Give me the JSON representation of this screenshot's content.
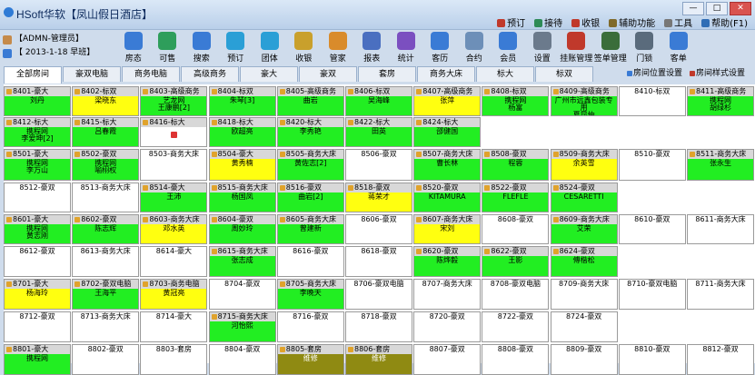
{
  "window": {
    "title": "HSoft华软【凤山假日酒店】",
    "buttons": [
      "—",
      "□",
      "✕"
    ]
  },
  "topmenu": [
    {
      "label": "预订",
      "color": "#c0392b"
    },
    {
      "label": "接待",
      "color": "#2e8b57"
    },
    {
      "label": "收银",
      "color": "#c0392b"
    },
    {
      "label": "辅助功能",
      "color": "#7f6a2b"
    },
    {
      "label": "工具",
      "color": "#777777"
    },
    {
      "label": "帮助(F1)",
      "color": "#2f6db5"
    }
  ],
  "user": {
    "name": "【ADMN-管理员】",
    "date": "【 2013-1-18 早班】"
  },
  "toolbar": [
    {
      "label": "房态",
      "icon": "home-icon",
      "color": "#3a7bd5"
    },
    {
      "label": "可售",
      "icon": "tag-icon",
      "color": "#2e9e5b"
    },
    {
      "label": "搜索",
      "icon": "search-icon",
      "color": "#3a7bd5"
    },
    {
      "label": "预订",
      "icon": "clock-icon",
      "color": "#2a9fd6"
    },
    {
      "label": "团体",
      "icon": "globe-icon",
      "color": "#2a9fd6"
    },
    {
      "label": "收银",
      "icon": "coins-icon",
      "color": "#c9a02c"
    },
    {
      "label": "管家",
      "icon": "broom-icon",
      "color": "#d98b2b"
    },
    {
      "label": "报表",
      "icon": "chart-icon",
      "color": "#4a6fc0"
    },
    {
      "label": "统计",
      "icon": "stats-icon",
      "color": "#7b4fc0"
    },
    {
      "label": "客历",
      "icon": "people-icon",
      "color": "#3a7bd5"
    },
    {
      "label": "合约",
      "icon": "contract-icon",
      "color": "#6d8fb8"
    },
    {
      "label": "会员",
      "icon": "member-icon",
      "color": "#3a7bd5"
    },
    {
      "label": "设置",
      "icon": "gear-icon",
      "color": "#6b7a8c"
    },
    {
      "label": "挂账管理",
      "icon": "ledger-icon",
      "color": "#c0392b"
    },
    {
      "label": "签单管理",
      "icon": "manager-icon",
      "color": "#3a6d3a"
    },
    {
      "label": "门锁",
      "icon": "lock-icon",
      "color": "#5a6b7c"
    },
    {
      "label": "客单",
      "icon": "guest-icon",
      "color": "#3a7bd5"
    }
  ],
  "tabs": [
    "全部房间",
    "豪双电脑",
    "商务电脑",
    "高级商务",
    "豪大",
    "豪双",
    "套房",
    "商务大床",
    "标大",
    "标双"
  ],
  "tab_actions": [
    {
      "label": "房间位置设置"
    },
    {
      "label": "房间样式设置"
    }
  ],
  "rows": [
    [
      {
        "hd": "8401-豪大",
        "st": "g",
        "l1": "刘丹"
      },
      {
        "hd": "8402-标双",
        "st": "y",
        "l1": "梁晓东"
      },
      {
        "hd": "8403-高级商务",
        "st": "g",
        "l1": "艺龙网",
        "l2": "王康鹏[2]"
      },
      {
        "hd": "8404-标双",
        "st": "g",
        "l1": "朱琴[3]"
      },
      {
        "hd": "8405-高级商务",
        "st": "g",
        "l1": "曲岩"
      },
      {
        "hd": "8406-标双",
        "st": "g",
        "l1": "吴海峰"
      },
      {
        "hd": "8407-高级商务",
        "st": "y",
        "l1": "张萍"
      },
      {
        "hd": "8408-标双",
        "st": "g",
        "l1": "携程网",
        "l2": "杨富"
      },
      {
        "hd": "8409-高级商务",
        "st": "g",
        "l1": "广州市远鑫包装专用",
        "l2": "夏昆仲"
      },
      {
        "hd": "8410-标双",
        "st": "plain"
      },
      {
        "hd": "8411-高级商务",
        "st": "g",
        "l1": "携程网",
        "l2": "胡绿杉"
      }
    ],
    [
      {
        "hd": "8412-标大",
        "st": "g",
        "l1": "携程网",
        "l2": "李爱坤[2]"
      },
      {
        "hd": "8415-标大",
        "st": "g",
        "l1": "吕春霞"
      },
      {
        "hd": "8416-标大",
        "st": "r",
        "dot": true
      },
      {
        "hd": "8418-标大",
        "st": "g",
        "l1": "欧超亮"
      },
      {
        "hd": "8420-标大",
        "st": "g",
        "l1": "李秀艳"
      },
      {
        "hd": "8422-标大",
        "st": "g",
        "l1": "田英"
      },
      {
        "hd": "8424-标大",
        "st": "g",
        "l1": "邵健国"
      },
      {
        "hd": "",
        "st": "none"
      },
      {
        "hd": "",
        "st": "none"
      },
      {
        "hd": "",
        "st": "none"
      },
      {
        "hd": "",
        "st": "none"
      }
    ],
    [
      {
        "hd": "8501-豪大",
        "st": "g",
        "l1": "携程网",
        "l2": "李万山"
      },
      {
        "hd": "8502-豪双",
        "st": "g",
        "l1": "携程网",
        "l2": "喻栩权"
      },
      {
        "hd": "8503-商务大床",
        "st": "plain"
      },
      {
        "hd": "8504-豪大",
        "st": "y",
        "l1": "黄秀楠"
      },
      {
        "hd": "8505-商务大床",
        "st": "g",
        "l1": "黄佐志[2]"
      },
      {
        "hd": "8506-豪双",
        "st": "plain"
      },
      {
        "hd": "8507-商务大床",
        "st": "g",
        "l1": "曹长林"
      },
      {
        "hd": "8508-豪双",
        "st": "g",
        "l1": "程蓉"
      },
      {
        "hd": "8509-商务大床",
        "st": "y",
        "l1": "余英雪"
      },
      {
        "hd": "8510-豪双",
        "st": "plain"
      },
      {
        "hd": "8511-商务大床",
        "st": "g",
        "l1": "张永生"
      }
    ],
    [
      {
        "hd": "8512-豪双",
        "st": "plain"
      },
      {
        "hd": "8513-商务大床",
        "st": "plain"
      },
      {
        "hd": "8514-豪大",
        "st": "g",
        "l1": "王沛"
      },
      {
        "hd": "8515-商务大床",
        "st": "g",
        "l1": "杨国凤"
      },
      {
        "hd": "8516-豪双",
        "st": "g",
        "l1": "曲岩[2]"
      },
      {
        "hd": "8518-豪双",
        "st": "y",
        "l1": "蒋荣才"
      },
      {
        "hd": "8520-豪双",
        "st": "g",
        "l1": "KITAMURA"
      },
      {
        "hd": "8522-豪双",
        "st": "g",
        "l1": "FLEFLE"
      },
      {
        "hd": "8524-豪双",
        "st": "g",
        "l1": "CESARETTI"
      },
      {
        "hd": "",
        "st": "none"
      },
      {
        "hd": "",
        "st": "none"
      }
    ],
    [
      {
        "hd": "8601-豪大",
        "st": "g",
        "l1": "携程网",
        "l2": "黄志刚"
      },
      {
        "hd": "8602-豪双",
        "st": "g",
        "l1": "陈志辉"
      },
      {
        "hd": "8603-商务大床",
        "st": "y",
        "l1": "邓水英"
      },
      {
        "hd": "8604-豪双",
        "st": "g",
        "l1": "周妙玲"
      },
      {
        "hd": "8605-商务大床",
        "st": "g",
        "l1": "曾建新"
      },
      {
        "hd": "8606-豪双",
        "st": "plain"
      },
      {
        "hd": "8607-商务大床",
        "st": "y",
        "l1": "宋刘"
      },
      {
        "hd": "8608-豪双",
        "st": "plain"
      },
      {
        "hd": "8609-商务大床",
        "st": "g",
        "l1": "艾荣"
      },
      {
        "hd": "8610-豪双",
        "st": "plain"
      },
      {
        "hd": "8611-商务大床",
        "st": "plain"
      }
    ],
    [
      {
        "hd": "8612-豪双",
        "st": "plain"
      },
      {
        "hd": "8613-商务大床",
        "st": "plain"
      },
      {
        "hd": "8614-豪大",
        "st": "plain"
      },
      {
        "hd": "8615-商务大床",
        "st": "g",
        "l1": "张志成"
      },
      {
        "hd": "8616-豪双",
        "st": "plain"
      },
      {
        "hd": "8618-豪双",
        "st": "plain"
      },
      {
        "hd": "8620-豪双",
        "st": "g",
        "l1": "陈烨毅"
      },
      {
        "hd": "8622-豪双",
        "st": "g",
        "l1": "王影"
      },
      {
        "hd": "8624-豪双",
        "st": "g",
        "l1": "傅楷松"
      },
      {
        "hd": "",
        "st": "none"
      },
      {
        "hd": "",
        "st": "none"
      }
    ],
    [
      {
        "hd": "8701-豪大",
        "st": "y",
        "l1": "杨海玲"
      },
      {
        "hd": "8702-豪双电脑",
        "st": "g",
        "l1": "王海平"
      },
      {
        "hd": "8703-商务电脑",
        "st": "y",
        "l1": "黄冠亮"
      },
      {
        "hd": "8704-豪双",
        "st": "plain"
      },
      {
        "hd": "8705-商务大床",
        "st": "g",
        "l1": "李晚天"
      },
      {
        "hd": "8706-豪双电脑",
        "st": "plain"
      },
      {
        "hd": "8707-商务大床",
        "st": "plain"
      },
      {
        "hd": "8708-豪双电脑",
        "st": "plain"
      },
      {
        "hd": "8709-商务大床",
        "st": "plain"
      },
      {
        "hd": "8710-豪双电脑",
        "st": "plain"
      },
      {
        "hd": "8711-商务大床",
        "st": "plain"
      }
    ],
    [
      {
        "hd": "8712-豪双",
        "st": "plain"
      },
      {
        "hd": "8713-商务大床",
        "st": "plain"
      },
      {
        "hd": "8714-豪大",
        "st": "plain"
      },
      {
        "hd": "8715-商务大床",
        "st": "g",
        "l1": "河怡熙"
      },
      {
        "hd": "8716-豪双",
        "st": "plain"
      },
      {
        "hd": "8718-豪双",
        "st": "plain"
      },
      {
        "hd": "8720-豪双",
        "st": "plain"
      },
      {
        "hd": "8722-豪双",
        "st": "plain"
      },
      {
        "hd": "8724-豪双",
        "st": "plain"
      },
      {
        "hd": "",
        "st": "none"
      },
      {
        "hd": "",
        "st": "none"
      }
    ],
    [
      {
        "hd": "8801-豪大",
        "st": "g",
        "l1": "携程网"
      },
      {
        "hd": "8802-豪双",
        "st": "plain"
      },
      {
        "hd": "8803-套房",
        "st": "plain"
      },
      {
        "hd": "8804-豪双",
        "st": "plain"
      },
      {
        "hd": "8805-套房",
        "st": "ol",
        "l1": "维修"
      },
      {
        "hd": "8806-套房",
        "st": "ol",
        "l1": "维修"
      },
      {
        "hd": "8807-豪双",
        "st": "plain"
      },
      {
        "hd": "8808-豪双",
        "st": "plain"
      },
      {
        "hd": "8809-豪双",
        "st": "plain"
      },
      {
        "hd": "8810-豪双",
        "st": "plain"
      },
      {
        "hd": "8812-豪双",
        "st": "plain"
      }
    ]
  ]
}
